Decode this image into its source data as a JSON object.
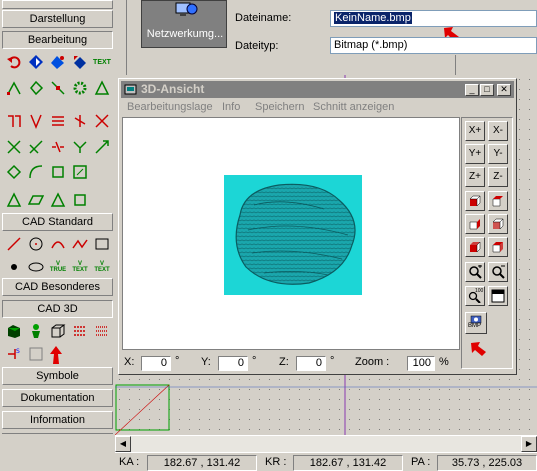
{
  "sidebar": {
    "sections": {
      "darstellung": "Darstellung",
      "bearbeitung": "Bearbeitung",
      "cad_standard": "CAD Standard",
      "cad_besonderes": "CAD Besonderes",
      "cad_3d": "CAD 3D",
      "symbole": "Symbole",
      "dokumentation": "Dokumentation",
      "information": "Information"
    },
    "text_icon_label": "TEXT",
    "true_icon_label": "TRUE"
  },
  "dialog": {
    "network_button": "Netzwerkumg...",
    "filename_label": "Dateiname:",
    "filename_value": "KeinName.bmp",
    "filetype_label": "Dateityp:",
    "filetype_value": "Bitmap (*.bmp)"
  },
  "window3d": {
    "title": "3D-Ansicht",
    "menu": {
      "bearbeitungslage": "Bearbeitungslage",
      "info": "Info",
      "speichern": "Speichern",
      "schnitt": "Schnitt anzeigen"
    },
    "buttons": {
      "xplus": "X+",
      "xminus": "X-",
      "yplus": "Y+",
      "yminus": "Y-",
      "zplus": "Z+",
      "zminus": "Z-",
      "zoom100": "100",
      "bmp": "BMP"
    },
    "coords": {
      "x_label": "X:",
      "x_value": "0",
      "x_unit": "°",
      "y_label": "Y:",
      "y_value": "0",
      "y_unit": "°",
      "z_label": "Z:",
      "z_value": "0",
      "z_unit": "°",
      "zoom_label": "Zoom :",
      "zoom_value": "100",
      "zoom_unit": "%"
    },
    "colors": {
      "render_background": "#1cd6d6",
      "object": "#1a9aa0"
    }
  },
  "statusbar": {
    "ka_label": "KA :",
    "ka_value": "182.67 , 131.42",
    "kr_label": "KR :",
    "kr_value": "182.67 , 131.42",
    "pa_label": "PA :",
    "pa_value": "35.73 , 225.03"
  },
  "colors": {
    "accent_arrow": "#e00000",
    "titlebar": "#808080",
    "selection": "#0a246a"
  }
}
